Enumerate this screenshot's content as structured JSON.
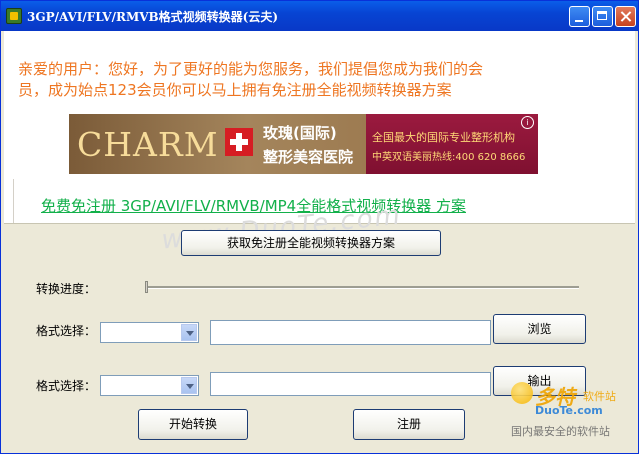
{
  "window": {
    "title": "3GP/AVI/FLV/RMVB格式视频转换器(云夫)"
  },
  "notice": {
    "line1": "亲爱的用户：您好，为了更好的能为您服务，我们提倡您成为我们的会",
    "line2": "员，成为始点123会员你可以马上拥有免注册全能视频转换器方案"
  },
  "ad": {
    "brand": "CHARM",
    "name_line1": "玫瑰(国际)",
    "name_line2": "整形美容医院",
    "tagline": "全国最大的国际专业整形机构",
    "hotline": "中英双语美丽热线:400 620 8666",
    "info_glyph": "i"
  },
  "promo_link": "免费免注册 3GP/AVI/FLV/RMVB/MP4全能格式视频转换器 方案",
  "buttons": {
    "get_plan": "获取免注册全能视频转换器方案",
    "browse": "浏览",
    "output": "输出",
    "start": "开始转换",
    "register": "注册"
  },
  "labels": {
    "progress": "转换进度：",
    "format1": "格式选择：",
    "format2": "格式选择："
  },
  "progress": {
    "value": 0
  },
  "fields": {
    "format1_value": "",
    "format2_value": "",
    "input_path": "",
    "output_path": ""
  },
  "watermark": {
    "logo": "多特",
    "logo_suffix": "软件站",
    "url": "DuoTe.com",
    "tagline": "国内最安全的软件站",
    "overlay": "www.DuoTe.com"
  },
  "colors": {
    "title_bar": "#0744d3",
    "notice_text": "#ee7622",
    "link_text": "#12b04a",
    "dialog_bg": "#ece9d8"
  }
}
